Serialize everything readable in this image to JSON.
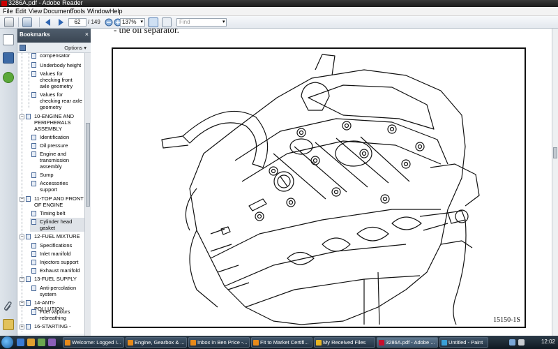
{
  "window": {
    "title": "3286A.pdf - Adobe Reader"
  },
  "menu": [
    "File",
    "Edit",
    "View",
    "Document",
    "Tools",
    "Window",
    "Help"
  ],
  "toolbar": {
    "page_current": "62",
    "page_total": "/ 149",
    "zoom": "137%",
    "find_placeholder": "Find"
  },
  "bookmarks": {
    "title": "Bookmarks",
    "close": "×",
    "options": "Options ▾",
    "items": [
      {
        "label": "compensator",
        "level": 2
      },
      {
        "label": "Underbody height",
        "level": 2
      },
      {
        "label": "Values for checking front axle geometry",
        "level": 2
      },
      {
        "label": "Values for checking rear axle geometry",
        "level": 2
      },
      {
        "label": "10-ENGINE AND PERIPHERALS ASSEMBLY",
        "level": 1
      },
      {
        "label": "Identification",
        "level": 2
      },
      {
        "label": "Oil pressure",
        "level": 2
      },
      {
        "label": "Engine and transmission assembly",
        "level": 2
      },
      {
        "label": "Sump",
        "level": 2
      },
      {
        "label": "Accessories support",
        "level": 2
      },
      {
        "label": "11-TOP AND FRONT OF ENGINE",
        "level": 1
      },
      {
        "label": "Timing belt",
        "level": 2
      },
      {
        "label": "Cylinder head gasket",
        "level": 2,
        "selected": true
      },
      {
        "label": "12-FUEL MIXTURE",
        "level": 1
      },
      {
        "label": "Specifications",
        "level": 2
      },
      {
        "label": "Inlet manifold",
        "level": 2
      },
      {
        "label": "Injectors support",
        "level": 2
      },
      {
        "label": "Exhaust manifold",
        "level": 2
      },
      {
        "label": "13-FUEL SUPPLY",
        "level": 1
      },
      {
        "label": "Anti-percolation system",
        "level": 2
      },
      {
        "label": "14-ANTI-POLLUTION",
        "level": 1
      },
      {
        "label": "Fuel vapours rebreathing",
        "level": 2
      },
      {
        "label": "16-STARTING -",
        "level": 1
      }
    ]
  },
  "document": {
    "top_text": "-   the oil separator.",
    "figure_label": "15150-1S"
  },
  "taskbar": {
    "tasks": [
      {
        "label": "Welcome: Logged I...",
        "color": "#e88a1a"
      },
      {
        "label": "Engine, Gearbox & ...",
        "color": "#e88a1a"
      },
      {
        "label": "Inbox in Ben Price -...",
        "color": "#e88a1a"
      },
      {
        "label": "Fit to Market Certifi...",
        "color": "#e88a1a"
      },
      {
        "label": "My Received Files",
        "color": "#e6b422"
      },
      {
        "label": "3286A.pdf - Adobe ...",
        "color": "#c8102e",
        "active": true
      },
      {
        "label": "Untitled - Paint",
        "color": "#3aa0d8"
      }
    ],
    "clock": "12:02"
  }
}
